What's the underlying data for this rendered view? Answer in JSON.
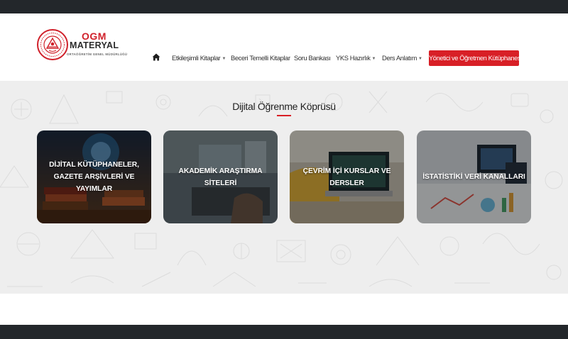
{
  "logo": {
    "title": "OGM",
    "subtitle": "MATERYAL",
    "tagline": "ORTAÖĞRETİM GENEL MÜDÜRLÜĞÜ",
    "brand_color": "#d0202a"
  },
  "nav": {
    "home_icon": "home-icon",
    "items": [
      {
        "label": "Etkileşimli Kitaplar",
        "has_dropdown": true
      },
      {
        "label": "Beceri Temelli Kitaplar",
        "has_dropdown": false
      },
      {
        "label": "Soru Bankası",
        "has_dropdown": false
      },
      {
        "label": "YKS Hazırlık",
        "has_dropdown": true
      },
      {
        "label": "Ders Anlatım",
        "has_dropdown": true
      }
    ],
    "cta_label": "Yönetici ve Öğretmen Kütüphanesi",
    "cta_color": "#d81f26"
  },
  "section": {
    "title": "Dijital Öğrenme Köprüsü",
    "cards": [
      {
        "label": "DİJİTAL KÜTÜPHANELER, GAZETE ARŞİVLERİ VE YAYIMLAR"
      },
      {
        "label": "AKADEMİK ARAŞTIRMA SİTELERİ"
      },
      {
        "label": "ÇEVRİM İÇİ KURSLAR VE DERSLER"
      },
      {
        "label": "İSTATİSTİKİ VERİ KANALLARI"
      }
    ]
  },
  "colors": {
    "top_bar": "#23272b",
    "footer": "#23272b",
    "content_bg": "#eeeeee",
    "accent": "#d81f26"
  }
}
